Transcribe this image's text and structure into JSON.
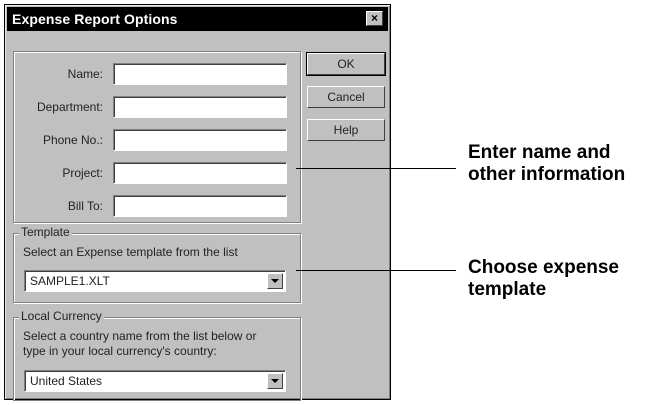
{
  "dialog": {
    "title": "Expense Report Options",
    "close_glyph": "×",
    "fields": [
      {
        "label": "Name:",
        "value": ""
      },
      {
        "label": "Department:",
        "value": ""
      },
      {
        "label": "Phone No.:",
        "value": ""
      },
      {
        "label": "Project:",
        "value": ""
      },
      {
        "label": "Bill To:",
        "value": ""
      }
    ],
    "buttons": {
      "ok": "OK",
      "cancel": "Cancel",
      "help": "Help"
    },
    "template": {
      "legend": "Template",
      "description": "Select an Expense template from the list",
      "selected": "SAMPLE1.XLT"
    },
    "currency": {
      "legend": "Local Currency",
      "description_line1": "Select a country name from the list below or",
      "description_line2": "type in your local currency's country:",
      "selected": "United States"
    }
  },
  "callouts": [
    {
      "line1": "Enter name and",
      "line2": "other information"
    },
    {
      "line1": "Choose expense",
      "line2": "template"
    }
  ]
}
